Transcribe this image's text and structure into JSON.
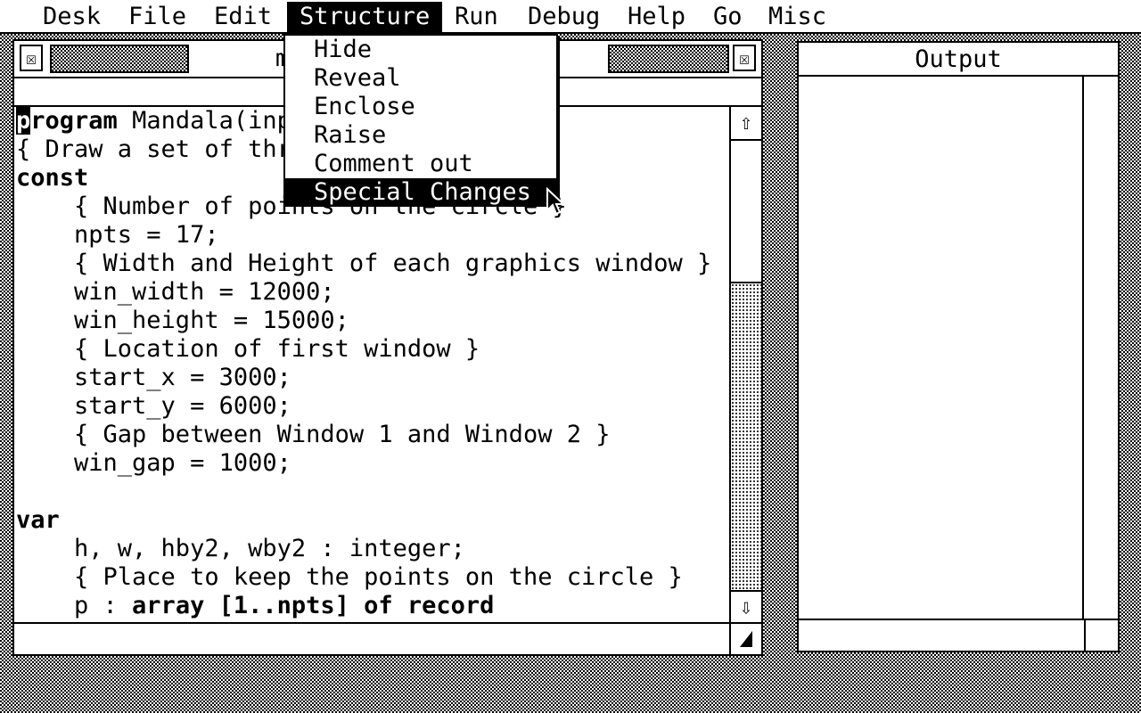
{
  "menubar": {
    "items": [
      "Desk",
      "File",
      "Edit",
      "Structure",
      "Run",
      "Debug",
      "Help",
      "Go",
      "Misc"
    ],
    "active": "Structure"
  },
  "structure_menu": {
    "items": [
      "Hide",
      "Reveal",
      "Enclose",
      "Raise",
      "Comment out",
      "Special Changes"
    ],
    "selected": "Special Changes"
  },
  "editor": {
    "title": "main: MANDALA.PAP",
    "close_glyph": "☒",
    "fuller_glyph": "☒",
    "scroll_up_glyph": "⇧",
    "scroll_down_glyph": "⇩",
    "code": [
      {
        "text": "program Mandala(input, output);",
        "keyword_prefix": "program"
      },
      {
        "text": "{ Draw a set of three windows }"
      },
      {
        "text": "const",
        "bold": true
      },
      {
        "text": "    { Number of points on the circle }"
      },
      {
        "text": "    npts = 17;"
      },
      {
        "text": "    { Width and Height of each graphics window }"
      },
      {
        "text": "    win_width = 12000;"
      },
      {
        "text": "    win_height = 15000;"
      },
      {
        "text": "    { Location of first window }"
      },
      {
        "text": "    start_x = 3000;"
      },
      {
        "text": "    start_y = 6000;"
      },
      {
        "text": "    { Gap between Window 1 and Window 2 }"
      },
      {
        "text": "    win_gap = 1000;"
      },
      {
        "text": ""
      },
      {
        "text": "var",
        "bold": true
      },
      {
        "text": "    h, w, hby2, wby2 : integer;"
      },
      {
        "text": "    { Place to keep the points on the circle }"
      },
      {
        "text": "    p : array [1..npts] of record"
      }
    ]
  },
  "output": {
    "title": "Output"
  }
}
